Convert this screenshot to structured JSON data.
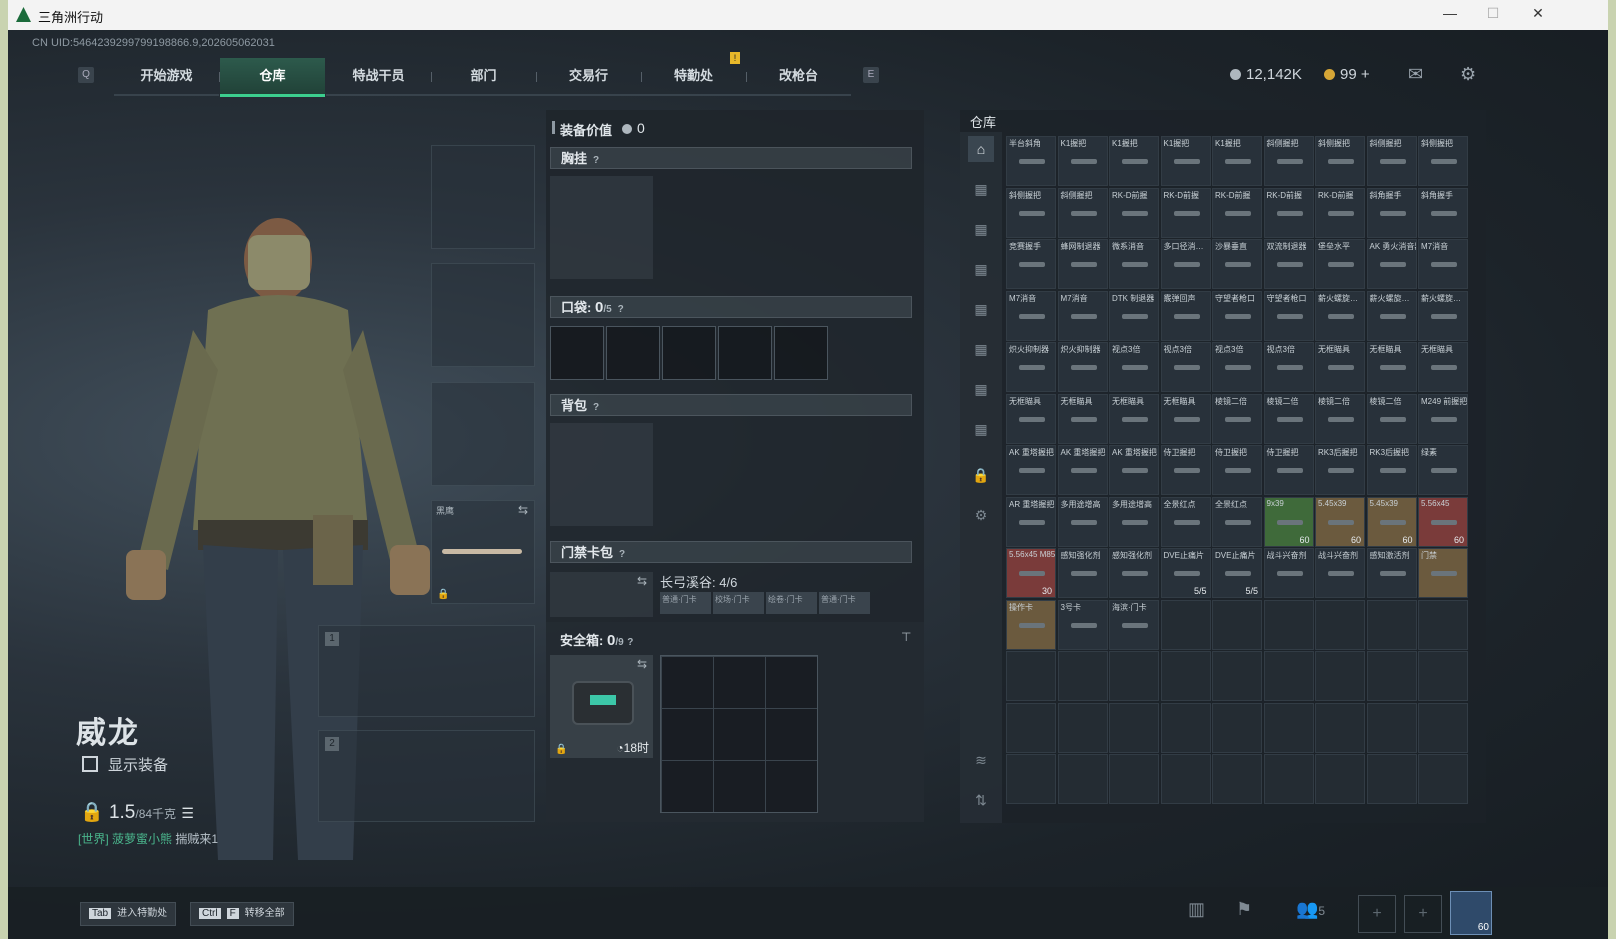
{
  "window": {
    "title": "三角洲行动",
    "minimize": "—",
    "maximize": "☐",
    "close": "✕"
  },
  "uid": "CN UID:5464239299799198866.9,202605062031",
  "nav": {
    "left_key": "Q",
    "right_key": "E",
    "tabs": [
      "开始游戏",
      "仓库",
      "特战干员",
      "部门",
      "交易行",
      "特勤处",
      "改枪台"
    ],
    "active": "仓库",
    "notice": "!"
  },
  "currency": {
    "silver": "12,142K",
    "gold": "99",
    "add": "+"
  },
  "operator": {
    "name": "威龙",
    "show_equipment": "显示装备",
    "weight": "1.5",
    "weight_cap": "/84千克",
    "chat_channel": "[世界]",
    "chat_user": "菠萝蜜小熊",
    "chat_text": "揣贼来1"
  },
  "loadout": {
    "melee_label": "黑鹰",
    "slot1": "1",
    "slot2": "2"
  },
  "equipment": {
    "value_label": "装备价值",
    "value": "0",
    "chest_rig": "胸挂",
    "pockets": "口袋:",
    "pockets_count": "0",
    "pockets_cap": "/5",
    "backpack": "背包",
    "keycard": "门禁卡包",
    "keycard_name": "长弓溪谷: 4/6",
    "keycard_slots": [
      "普通·门卡",
      "校场·门卡",
      "绘卷·门卡",
      "普通·门卡"
    ],
    "safe_box": "安全箱:",
    "safe_count": "0",
    "safe_cap": "/9",
    "safe_timer": "18时",
    "help": "?"
  },
  "stash": {
    "title": "仓库",
    "items": [
      [
        "半台斜角",
        "",
        ""
      ],
      [
        "K1握把",
        "",
        ""
      ],
      [
        "K1握把",
        "",
        ""
      ],
      [
        "K1握把",
        "",
        ""
      ],
      [
        "K1握把",
        "",
        ""
      ],
      [
        "斜侧握把",
        "",
        ""
      ],
      [
        "斜侧握把",
        "",
        ""
      ],
      [
        "斜侧握把",
        "",
        ""
      ],
      [
        "斜侧握把",
        "",
        ""
      ],
      [
        "斜侧握把",
        "",
        ""
      ],
      [
        "斜侧握把",
        "",
        ""
      ],
      [
        "RK-D前握",
        "",
        ""
      ],
      [
        "RK-D前握",
        "",
        ""
      ],
      [
        "RK-D前握",
        "",
        ""
      ],
      [
        "RK-D前握",
        "",
        ""
      ],
      [
        "RK-D前握",
        "",
        ""
      ],
      [
        "斜角握手",
        "",
        ""
      ],
      [
        "斜角握手",
        "",
        ""
      ],
      [
        "竞赛握手",
        "",
        ""
      ],
      [
        "蜂网制退器",
        "",
        ""
      ],
      [
        "微系消音",
        "",
        ""
      ],
      [
        "多口径消…",
        "",
        ""
      ],
      [
        "沙暴垂直",
        "",
        ""
      ],
      [
        "双流制退器",
        "",
        ""
      ],
      [
        "堡垒水平",
        "",
        ""
      ],
      [
        "AK 勇火消音器",
        "",
        ""
      ],
      [
        "M7消音",
        "",
        ""
      ],
      [
        "M7消音",
        "",
        ""
      ],
      [
        "M7消音",
        "",
        ""
      ],
      [
        "DTK 制退器",
        "",
        ""
      ],
      [
        "霰弹回声",
        "",
        ""
      ],
      [
        "守望者枪口",
        "",
        ""
      ],
      [
        "守望者枪口",
        "",
        ""
      ],
      [
        "薪火螺旋…",
        "",
        ""
      ],
      [
        "薪火螺旋…",
        "",
        ""
      ],
      [
        "薪火螺旋…",
        "",
        ""
      ],
      [
        "炽火抑制器",
        "",
        ""
      ],
      [
        "炽火抑制器",
        "",
        ""
      ],
      [
        "视点3倍",
        "",
        ""
      ],
      [
        "视点3倍",
        "",
        ""
      ],
      [
        "视点3倍",
        "",
        ""
      ],
      [
        "视点3倍",
        "",
        ""
      ],
      [
        "无框瞄具",
        "",
        ""
      ],
      [
        "无框瞄具",
        "",
        ""
      ],
      [
        "无框瞄具",
        "",
        ""
      ],
      [
        "无框瞄具",
        "",
        ""
      ],
      [
        "无框瞄具",
        "",
        ""
      ],
      [
        "无框瞄具",
        "",
        ""
      ],
      [
        "无框瞄具",
        "",
        ""
      ],
      [
        "棱镜二倍",
        "",
        ""
      ],
      [
        "棱镜二倍",
        "",
        ""
      ],
      [
        "棱镜二倍",
        "",
        ""
      ],
      [
        "棱镜二倍",
        "",
        ""
      ],
      [
        "M249 前握把木",
        "",
        ""
      ],
      [
        "AK 重塔握把",
        "",
        ""
      ],
      [
        "AK 重塔握把",
        "",
        ""
      ],
      [
        "AK 重塔握把",
        "",
        ""
      ],
      [
        "侍卫握把",
        "",
        ""
      ],
      [
        "侍卫握把",
        "",
        ""
      ],
      [
        "侍卫握把",
        "",
        ""
      ],
      [
        "RK3后握把",
        "",
        ""
      ],
      [
        "RK3后握把",
        "",
        ""
      ],
      [
        "绿素",
        "",
        ""
      ],
      [
        "AR 重塔握把",
        "",
        ""
      ],
      [
        "多用途增高",
        "",
        ""
      ],
      [
        "多用途增高",
        "",
        ""
      ],
      [
        "全景红点",
        "",
        ""
      ],
      [
        "全景红点",
        "",
        ""
      ],
      [
        "9x39",
        "60",
        "green"
      ],
      [
        "5.45x39",
        "60",
        "gold"
      ],
      [
        "5.45x39",
        "60",
        "gold"
      ],
      [
        "5.56x45",
        "60",
        "red"
      ],
      [
        "5.56x45 M855A1",
        "30",
        "red"
      ],
      [
        "感知强化剂",
        "",
        ""
      ],
      [
        "感知强化剂",
        "",
        ""
      ],
      [
        "DVE止痛片",
        "5/5",
        ""
      ],
      [
        "DVE止痛片",
        "5/5",
        ""
      ],
      [
        "战斗兴奋剂",
        "",
        ""
      ],
      [
        "战斗兴奋剂",
        "",
        ""
      ],
      [
        "感知激活剂",
        "",
        ""
      ],
      [
        "门禁",
        "",
        "gold"
      ],
      [
        "操作卡",
        "",
        "gold"
      ],
      [
        "3号卡",
        "",
        ""
      ],
      [
        "海滨·门卡",
        "",
        ""
      ]
    ]
  },
  "bottom": {
    "tab_key": "Tab",
    "tab_label": "进入特勤处",
    "ctrl_key": "Ctrl",
    "f_key": "F",
    "transfer_label": "转移全部",
    "squad_count": "5",
    "level": "60"
  }
}
